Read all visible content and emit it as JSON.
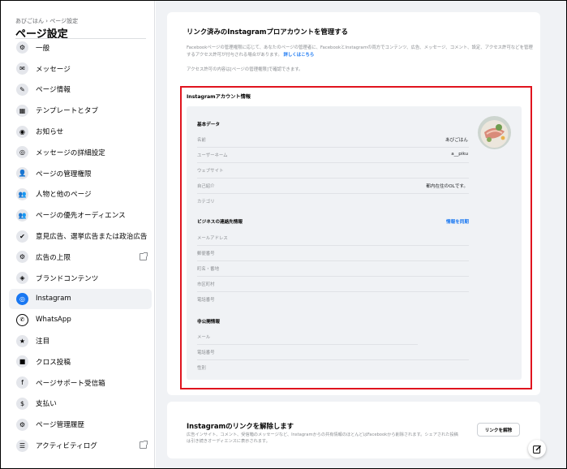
{
  "sidebar": {
    "breadcrumb": "あびごはん › ページ設定",
    "title": "ページ設定",
    "items": [
      {
        "label": "一般",
        "glyph": "⚙"
      },
      {
        "label": "メッセージ",
        "glyph": "✉"
      },
      {
        "label": "ページ情報",
        "glyph": "✎"
      },
      {
        "label": "テンプレートとタブ",
        "glyph": "▦"
      },
      {
        "label": "お知らせ",
        "glyph": "◉"
      },
      {
        "label": "メッセージの詳細設定",
        "glyph": "◎"
      },
      {
        "label": "ページの管理権限",
        "glyph": "👤"
      },
      {
        "label": "人物と他のページ",
        "glyph": "👥"
      },
      {
        "label": "ページの優先オーディエンス",
        "glyph": "👥"
      },
      {
        "label": "意見広告、選挙広告または政治広告",
        "glyph": "✔"
      },
      {
        "label": "広告の上限",
        "glyph": "⚙",
        "external": true
      },
      {
        "label": "ブランドコンテンツ",
        "glyph": "◈"
      },
      {
        "label": "Instagram",
        "glyph": "◎",
        "active": true
      },
      {
        "label": "WhatsApp",
        "glyph": "✆",
        "whatsapp": true
      },
      {
        "label": "注目",
        "glyph": "★"
      },
      {
        "label": "クロス投稿",
        "glyph": "■"
      },
      {
        "label": "ページサポート受信箱",
        "glyph": "f"
      },
      {
        "label": "支払い",
        "glyph": "$"
      },
      {
        "label": "ページ管理履歴",
        "glyph": "⚙"
      },
      {
        "label": "アクティビティログ",
        "glyph": "☰",
        "external": true
      }
    ]
  },
  "main": {
    "title": "リンク済みのInstagramプロアカウントを管理する",
    "description": "Facebookページの管理権限に応じて、あなたのページの管理者に、FacebookとInstagramの両方でコンテンツ、広告、メッセージ、コメント、設定、アクセス許可などを管理するアクセス許可が付与される場合があります。",
    "learn_more": "詳しくはこちら",
    "permissions_note": "アクセス許可の内容は[ページの管理権限]で確認できます。",
    "info_heading": "Instagramアカウント情報",
    "basic_data": {
      "heading": "基本データ",
      "rows": [
        {
          "label": "名前",
          "value": "あびごはん"
        },
        {
          "label": "ユーザーネーム",
          "value": "a__piku"
        },
        {
          "label": "ウェブサイト",
          "value": ""
        },
        {
          "label": "自己紹介",
          "value": "都内在住のOLです。"
        },
        {
          "label": "カテゴリ",
          "value": ""
        }
      ]
    },
    "business_contact": {
      "heading": "ビジネスの連絡先情報",
      "sync_label": "情報を同期",
      "rows": [
        {
          "label": "メールアドレス"
        },
        {
          "label": "郵便番号"
        },
        {
          "label": "町名・番地"
        },
        {
          "label": "市区町村"
        },
        {
          "label": "電話番号"
        }
      ]
    },
    "private_info": {
      "heading": "非公開情報",
      "rows": [
        {
          "label": "メール"
        },
        {
          "label": "電話番号"
        },
        {
          "label": "性別"
        }
      ]
    },
    "unlink": {
      "title": "Instagramのリンクを解除します",
      "description": "広告インサイト、コメント、受信箱のメッセージなど、Instagramからの共有情報のほとんどはFacebookから削除されます。シェアされた投稿は引き続きオーディエンスに表示されます。",
      "button": "リンクを解除"
    }
  },
  "colors": {
    "accent": "#1877f2",
    "highlight_border": "#e0141e",
    "panel_bg": "#f0f2f5"
  }
}
